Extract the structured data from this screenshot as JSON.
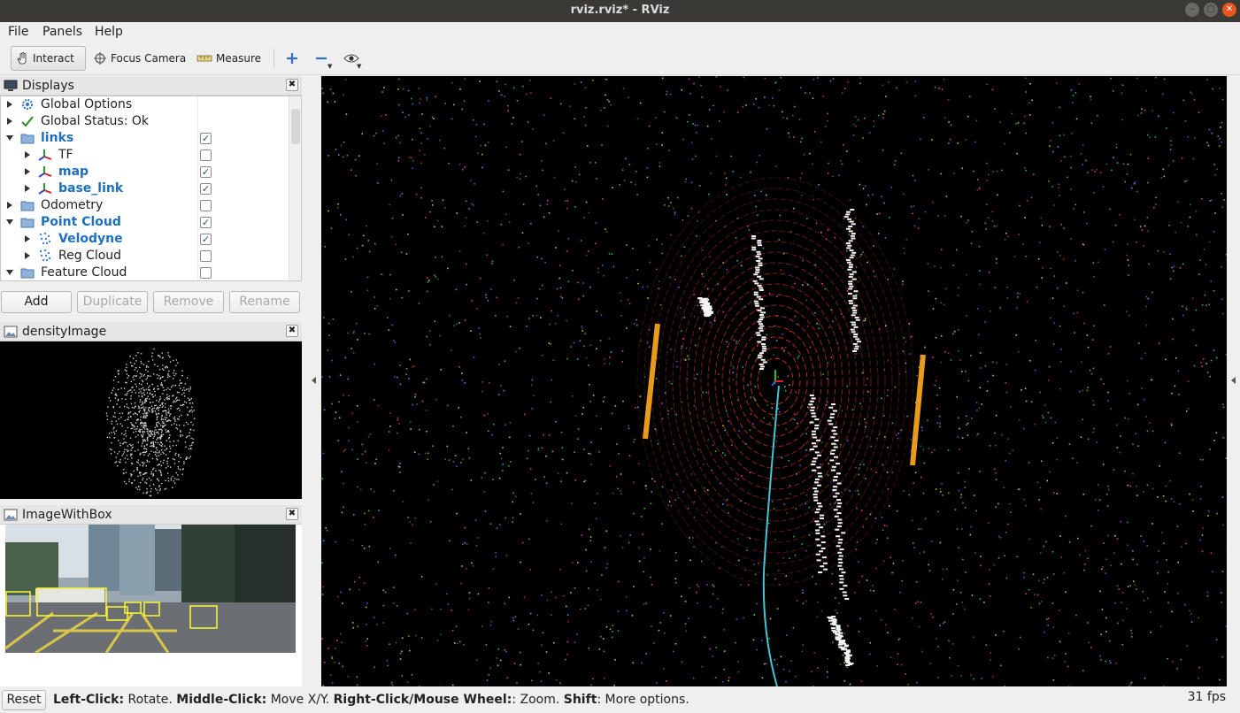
{
  "window": {
    "title": "rviz.rviz* - RViz"
  },
  "menu": {
    "file": "File",
    "panels": "Panels",
    "help": "Help"
  },
  "toolbar": {
    "interact": "Interact",
    "focus_camera": "Focus Camera",
    "measure": "Measure"
  },
  "displays": {
    "title": "Displays",
    "items": [
      {
        "label": "Global Options",
        "icon": "gear-icon",
        "depth": 0,
        "expanded": false,
        "highlight": false,
        "checkbox": null
      },
      {
        "label": "Global Status: Ok",
        "icon": "check-icon",
        "depth": 0,
        "expanded": false,
        "highlight": false,
        "checkbox": null
      },
      {
        "label": "links",
        "icon": "folder-icon",
        "depth": 0,
        "expanded": true,
        "highlight": true,
        "checkbox": true
      },
      {
        "label": "TF",
        "icon": "axes-icon",
        "depth": 1,
        "expanded": false,
        "highlight": false,
        "checkbox": false
      },
      {
        "label": "map",
        "icon": "axes-icon",
        "depth": 1,
        "expanded": false,
        "highlight": true,
        "checkbox": true
      },
      {
        "label": "base_link",
        "icon": "axes-icon",
        "depth": 1,
        "expanded": false,
        "highlight": true,
        "checkbox": true
      },
      {
        "label": "Odometry",
        "icon": "folder-icon",
        "depth": 0,
        "expanded": false,
        "highlight": false,
        "checkbox": false
      },
      {
        "label": "Point Cloud",
        "icon": "folder-icon",
        "depth": 0,
        "expanded": true,
        "highlight": true,
        "checkbox": true
      },
      {
        "label": "Velodyne",
        "icon": "pointcloud-icon",
        "depth": 1,
        "expanded": false,
        "highlight": true,
        "checkbox": true
      },
      {
        "label": "Reg Cloud",
        "icon": "pointcloud-icon",
        "depth": 1,
        "expanded": false,
        "highlight": false,
        "checkbox": false
      },
      {
        "label": "Feature Cloud",
        "icon": "folder-icon",
        "depth": 0,
        "expanded": true,
        "highlight": false,
        "checkbox": false
      }
    ],
    "buttons": {
      "add": "Add",
      "duplicate": "Duplicate",
      "remove": "Remove",
      "rename": "Rename"
    }
  },
  "panels": {
    "density_image": "densityImage",
    "image_with_box": "ImageWithBox"
  },
  "status": {
    "reset": "Reset",
    "left_click": "Left-Click:",
    "left_action": " Rotate. ",
    "middle_click": "Middle-Click:",
    "middle_action": " Move X/Y. ",
    "right_click": "Right-Click/Mouse Wheel:",
    "right_action": ": Zoom. ",
    "shift": "Shift",
    "shift_action": ": More options.",
    "fps": "31 fps"
  },
  "colors": {
    "highlight_text": "#1f6fc0",
    "title_bar": "#3a3935",
    "close_button": "#e9541f"
  }
}
